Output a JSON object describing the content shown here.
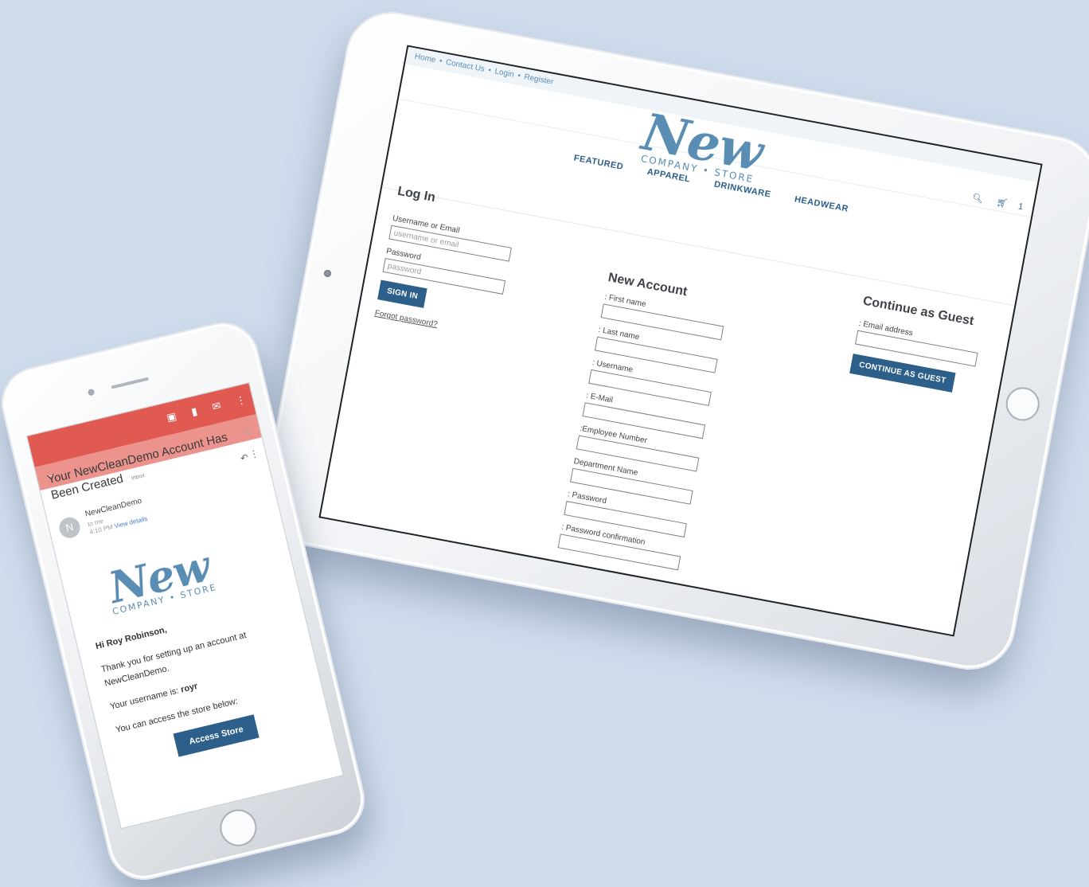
{
  "store": {
    "logo_word": "New",
    "logo_sub": "COMPANY • STORE",
    "topbar": {
      "home": "Home",
      "contact": "Contact Us",
      "login": "Login",
      "register": "Register",
      "sep": "•"
    },
    "cart_count": "1",
    "nav": [
      "FEATURED",
      "APPAREL",
      "DRINKWARE",
      "HEADWEAR"
    ],
    "login": {
      "title": "Log In",
      "username_label": "Username or Email",
      "username_placeholder": "username or email",
      "password_label": "Password",
      "password_placeholder": "password",
      "signin_button": "SIGN IN",
      "forgot": "Forgot password?"
    },
    "new_account": {
      "title": "New Account",
      "fields": [
        ": First name",
        ": Last name",
        ": Username",
        ": E-Mail",
        ":Employee Number",
        "Department Name",
        ": Password",
        ": Password confirmation"
      ]
    },
    "guest": {
      "title": "Continue as Guest",
      "email_label": ": Email address",
      "button": "CONTINUE AS GUEST"
    }
  },
  "email": {
    "subject": "Your NewCleanDemo Account Has Been Created",
    "inbox_badge": "Inbox",
    "avatar_letter": "N",
    "sender": "NewCleanDemo",
    "to": "to me",
    "time": "4:10 PM",
    "view_details": "View details",
    "greeting": "Hi Roy Robinson,",
    "line1": "Thank you for setting up an account at NewCleanDemo.",
    "username_prefix": "Your username is:",
    "username": "royr",
    "line3": "You can access the store below:",
    "access_button": "Access Store"
  },
  "colors": {
    "background": "#cfdcec",
    "brand_blue": "#2c5f8a",
    "logo_blue": "#5a8db4",
    "gmail_red": "#e05a52"
  },
  "icons": [
    "search-icon",
    "cart-icon",
    "back-arrow-icon",
    "archive-icon",
    "trash-icon",
    "mail-icon",
    "more-icon",
    "star-icon",
    "reply-icon"
  ]
}
